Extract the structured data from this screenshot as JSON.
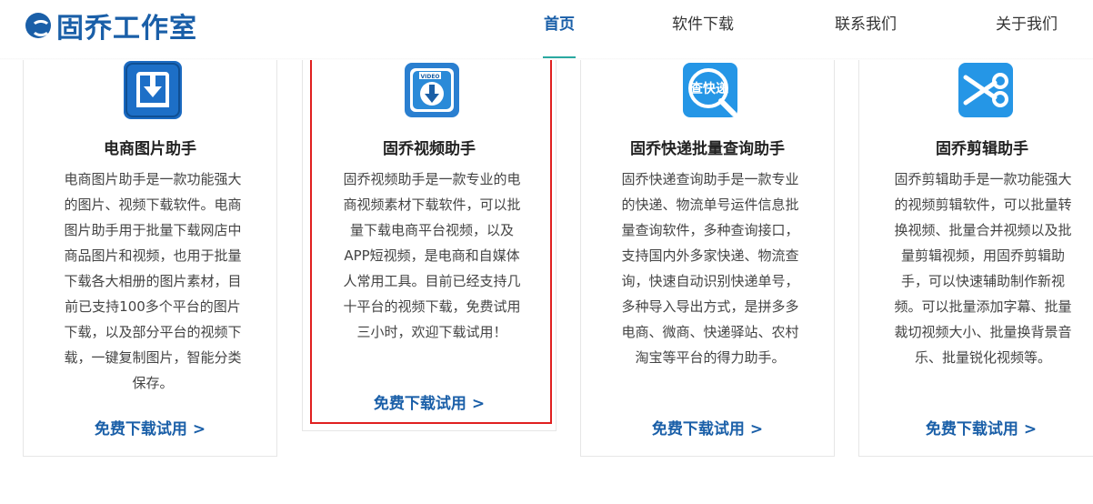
{
  "header": {
    "logo_text": "固乔工作室",
    "nav": [
      "首页",
      "软件下载",
      "联系我们",
      "关于我们"
    ]
  },
  "cards": [
    {
      "title": "电商图片助手",
      "description": "电商图片助手是一款功能强大的图片、视频下载软件。电商图片助手用于批量下载网店中商品图片和视频，也用于批量下载各大相册的图片素材，目前已支持100多个平台的图片下载，以及部分平台的视频下载，一键复制图片，智能分类保存。",
      "link": "免费下载试用 >",
      "icon": "download-icon"
    },
    {
      "title": "固乔视频助手",
      "description": "固乔视频助手是一款专业的电商视频素材下载软件，可以批量下载电商平台视频，以及APP短视频，是电商和自媒体人常用工具。目前已经支持几十平台的视频下载，免费试用三小时，欢迎下载试用！",
      "link": "免费下载试用 >",
      "icon": "video-download-icon",
      "icon_label": "VIDEO"
    },
    {
      "title": "固乔快递批量查询助手",
      "description": "固乔快递查询助手是一款专业的快递、物流单号运件信息批量查询软件，多种查询接口，支持国内外多家快递、物流查询，快速自动识别快递单号，多种导入导出方式，是拼多多电商、微商、快递驿站、农村淘宝等平台的得力助手。",
      "link": "免费下载试用 >",
      "icon": "express-search-icon",
      "icon_label": "查快递"
    },
    {
      "title": "固乔剪辑助手",
      "description": "固乔剪辑助手是一款功能强大的视频剪辑软件，可以批量转换视频、批量合并视频以及批量剪辑视频，用固乔剪辑助手，可以快速辅助制作新视频。可以批量添加字幕、批量裁切视频大小、批量换背景音乐、批量锐化视频等。",
      "link": "免费下载试用 >",
      "icon": "scissors-icon"
    }
  ],
  "colors": {
    "brand": "#1a5fa8",
    "nav_underline": "#2aa9a1",
    "highlight": "#e02020"
  }
}
